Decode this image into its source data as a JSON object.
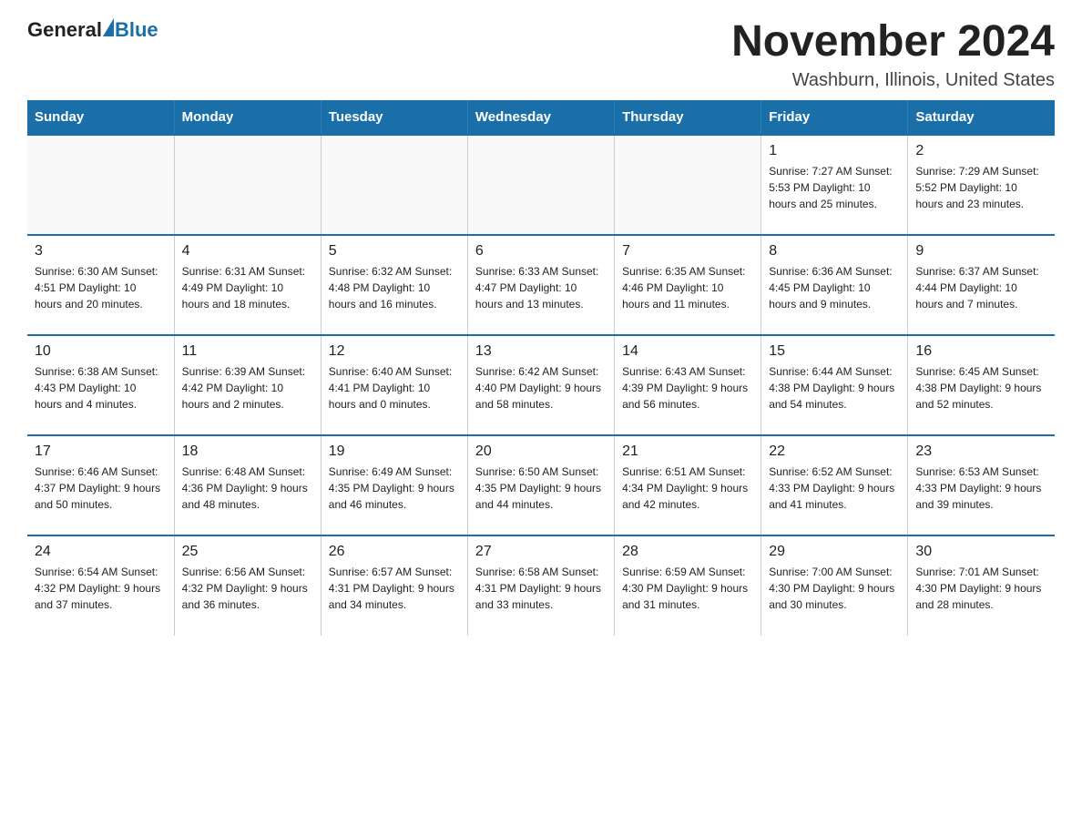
{
  "logo": {
    "general": "General",
    "blue": "Blue"
  },
  "title": "November 2024",
  "location": "Washburn, Illinois, United States",
  "days_of_week": [
    "Sunday",
    "Monday",
    "Tuesday",
    "Wednesday",
    "Thursday",
    "Friday",
    "Saturday"
  ],
  "weeks": [
    [
      {
        "day": "",
        "info": ""
      },
      {
        "day": "",
        "info": ""
      },
      {
        "day": "",
        "info": ""
      },
      {
        "day": "",
        "info": ""
      },
      {
        "day": "",
        "info": ""
      },
      {
        "day": "1",
        "info": "Sunrise: 7:27 AM\nSunset: 5:53 PM\nDaylight: 10 hours and 25 minutes."
      },
      {
        "day": "2",
        "info": "Sunrise: 7:29 AM\nSunset: 5:52 PM\nDaylight: 10 hours and 23 minutes."
      }
    ],
    [
      {
        "day": "3",
        "info": "Sunrise: 6:30 AM\nSunset: 4:51 PM\nDaylight: 10 hours and 20 minutes."
      },
      {
        "day": "4",
        "info": "Sunrise: 6:31 AM\nSunset: 4:49 PM\nDaylight: 10 hours and 18 minutes."
      },
      {
        "day": "5",
        "info": "Sunrise: 6:32 AM\nSunset: 4:48 PM\nDaylight: 10 hours and 16 minutes."
      },
      {
        "day": "6",
        "info": "Sunrise: 6:33 AM\nSunset: 4:47 PM\nDaylight: 10 hours and 13 minutes."
      },
      {
        "day": "7",
        "info": "Sunrise: 6:35 AM\nSunset: 4:46 PM\nDaylight: 10 hours and 11 minutes."
      },
      {
        "day": "8",
        "info": "Sunrise: 6:36 AM\nSunset: 4:45 PM\nDaylight: 10 hours and 9 minutes."
      },
      {
        "day": "9",
        "info": "Sunrise: 6:37 AM\nSunset: 4:44 PM\nDaylight: 10 hours and 7 minutes."
      }
    ],
    [
      {
        "day": "10",
        "info": "Sunrise: 6:38 AM\nSunset: 4:43 PM\nDaylight: 10 hours and 4 minutes."
      },
      {
        "day": "11",
        "info": "Sunrise: 6:39 AM\nSunset: 4:42 PM\nDaylight: 10 hours and 2 minutes."
      },
      {
        "day": "12",
        "info": "Sunrise: 6:40 AM\nSunset: 4:41 PM\nDaylight: 10 hours and 0 minutes."
      },
      {
        "day": "13",
        "info": "Sunrise: 6:42 AM\nSunset: 4:40 PM\nDaylight: 9 hours and 58 minutes."
      },
      {
        "day": "14",
        "info": "Sunrise: 6:43 AM\nSunset: 4:39 PM\nDaylight: 9 hours and 56 minutes."
      },
      {
        "day": "15",
        "info": "Sunrise: 6:44 AM\nSunset: 4:38 PM\nDaylight: 9 hours and 54 minutes."
      },
      {
        "day": "16",
        "info": "Sunrise: 6:45 AM\nSunset: 4:38 PM\nDaylight: 9 hours and 52 minutes."
      }
    ],
    [
      {
        "day": "17",
        "info": "Sunrise: 6:46 AM\nSunset: 4:37 PM\nDaylight: 9 hours and 50 minutes."
      },
      {
        "day": "18",
        "info": "Sunrise: 6:48 AM\nSunset: 4:36 PM\nDaylight: 9 hours and 48 minutes."
      },
      {
        "day": "19",
        "info": "Sunrise: 6:49 AM\nSunset: 4:35 PM\nDaylight: 9 hours and 46 minutes."
      },
      {
        "day": "20",
        "info": "Sunrise: 6:50 AM\nSunset: 4:35 PM\nDaylight: 9 hours and 44 minutes."
      },
      {
        "day": "21",
        "info": "Sunrise: 6:51 AM\nSunset: 4:34 PM\nDaylight: 9 hours and 42 minutes."
      },
      {
        "day": "22",
        "info": "Sunrise: 6:52 AM\nSunset: 4:33 PM\nDaylight: 9 hours and 41 minutes."
      },
      {
        "day": "23",
        "info": "Sunrise: 6:53 AM\nSunset: 4:33 PM\nDaylight: 9 hours and 39 minutes."
      }
    ],
    [
      {
        "day": "24",
        "info": "Sunrise: 6:54 AM\nSunset: 4:32 PM\nDaylight: 9 hours and 37 minutes."
      },
      {
        "day": "25",
        "info": "Sunrise: 6:56 AM\nSunset: 4:32 PM\nDaylight: 9 hours and 36 minutes."
      },
      {
        "day": "26",
        "info": "Sunrise: 6:57 AM\nSunset: 4:31 PM\nDaylight: 9 hours and 34 minutes."
      },
      {
        "day": "27",
        "info": "Sunrise: 6:58 AM\nSunset: 4:31 PM\nDaylight: 9 hours and 33 minutes."
      },
      {
        "day": "28",
        "info": "Sunrise: 6:59 AM\nSunset: 4:30 PM\nDaylight: 9 hours and 31 minutes."
      },
      {
        "day": "29",
        "info": "Sunrise: 7:00 AM\nSunset: 4:30 PM\nDaylight: 9 hours and 30 minutes."
      },
      {
        "day": "30",
        "info": "Sunrise: 7:01 AM\nSunset: 4:30 PM\nDaylight: 9 hours and 28 minutes."
      }
    ]
  ]
}
